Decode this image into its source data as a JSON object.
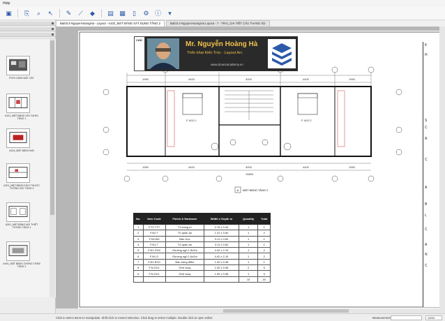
{
  "menu": {
    "label": "Help"
  },
  "toolbar": {
    "icons": [
      "open-icon",
      "save-icon",
      "zoom-icon",
      "select-icon",
      "pen-icon",
      "measure-icon",
      "fill-icon",
      "stamp-icon",
      "layers-icon",
      "page-icon",
      "settings-icon",
      "info-icon"
    ]
  },
  "tabs": [
    {
      "label": "Bai03.4-NguyenHoangHa - Layout - A102_MẶT BẰNG XÁT DỤNG TẦNG 2"
    },
    {
      "label": "Bai03.4-NguyenHoangHa Layout - 7 - TRÁI_CHI TIẾT CẦU THANG 0/2"
    }
  ],
  "thumbnails": [
    {
      "label": "PHỐI CẢNH MẶT CẮT"
    },
    {
      "label": "A101_MẶT BẰNG XÂY DỰNG TẦNG 1"
    },
    {
      "label": "A104_MẶT BẰNG MÁI"
    },
    {
      "label": "A201_MẶT BẰNG KÍCH THƯỚC TƯỜNG XÂY TẦNG 2"
    },
    {
      "label": "A301_MẶT BẰNG NOI THIẾT TƯỜNG TẦNG 1"
    },
    {
      "label": "A401_MẶT BẰNG CHỐNG THẤM TẦNG 2"
    }
  ],
  "banner": {
    "name": "Mr. Nguyễn Hoàng Hà",
    "subtitle": "Triển khai Kiến Trúc - Layout Arc",
    "website": "www.dovezacademy.vn"
  },
  "plan": {
    "sheet_prefix": "CHỦ",
    "label": "MẶT BẰNG TẦNG 2",
    "label_id": "A",
    "dims_top": [
      "1950",
      "4400",
      "3000",
      "4400",
      "1950"
    ],
    "dims_bottom": [
      "1950",
      "4400",
      "3000",
      "4400",
      "1950"
    ],
    "total_dim": "15800",
    "room_left": "P. NGỦ 1",
    "room_right": "P. NGỦ 2",
    "grid_letters": [
      "A",
      "B",
      "C",
      "D"
    ],
    "grid_numbers": [
      "1",
      "2",
      "3",
      "4",
      "5",
      "6"
    ]
  },
  "schedule": {
    "headers": [
      "No.",
      "Item Code",
      "Finish & Hardware",
      "Width x Depth m",
      "Quantity",
      "Total"
    ],
    "rows": [
      [
        "1",
        "F.T2.TTT",
        "Tủ trang trí",
        "2.76 x 0.40",
        "1",
        "1"
      ],
      [
        "2",
        "F.N2.T",
        "Tủ quần áo",
        "1.31 x 0.60",
        "1",
        "2"
      ],
      [
        "3",
        "F.N2.BH",
        "Bàn Học",
        "3.11 x 0.60",
        "1",
        "1"
      ],
      [
        "4",
        "F.N1.T",
        "Tủ quần áo",
        "3.11 x 0.60",
        "1",
        "1"
      ],
      [
        "5",
        "F.N1.GH2",
        "Giường ngủ 1.8x2m",
        "4.42 x 2.10",
        "1",
        "2"
      ],
      [
        "6",
        "F.N1.G",
        "Giường ngủ 1.6x2m",
        "4.42 x 2.10",
        "1",
        "2"
      ],
      [
        "7",
        "F.N1.BTD",
        "Bàn trang điểm",
        "1.00 x 0.38",
        "1",
        "1"
      ],
      [
        "8",
        "F.N.GX1",
        "Ghế xoay",
        "1.00 x 0.98",
        "2",
        "5"
      ],
      [
        "9",
        "F.N.GX1",
        "Ghế xoay",
        "1.00 x 0.98",
        "1",
        "5"
      ],
      [
        "",
        "",
        "",
        "",
        "10",
        "20"
      ]
    ]
  },
  "titleblock": {
    "letters": [
      "K",
      "H",
      "S",
      "C",
      "A",
      "C",
      "A",
      "B",
      "L",
      "C",
      "A",
      "N",
      "C"
    ]
  },
  "status": {
    "message": "Click to select items to manipulate. Shift click to extend selection. Click drag to select multiple. Double click to open editor.",
    "measurements": "Measurements",
    "zoom": "100%"
  },
  "colors": {
    "banner_text": "#f0c14b",
    "sheet": "#ffffff",
    "canvas": "#b6b6b6"
  }
}
